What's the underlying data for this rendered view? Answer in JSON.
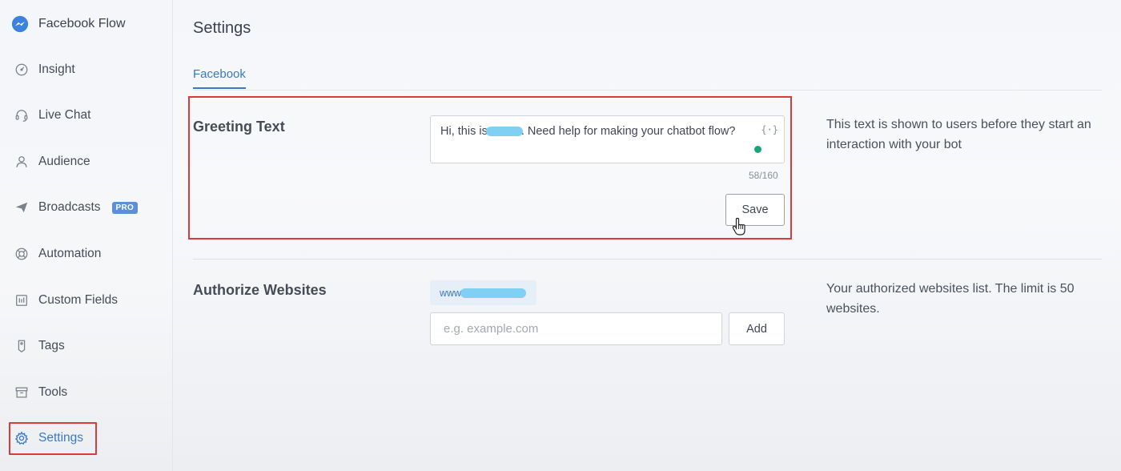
{
  "brand": {
    "label": "Facebook Flow",
    "icon": "messenger-icon"
  },
  "sidebar": {
    "items": [
      {
        "label": "Insight",
        "icon": "gauge-icon"
      },
      {
        "label": "Live Chat",
        "icon": "headset-icon"
      },
      {
        "label": "Audience",
        "icon": "user-icon"
      },
      {
        "label": "Broadcasts",
        "icon": "send-icon",
        "badge": "PRO"
      },
      {
        "label": "Automation",
        "icon": "lifebuoy-icon"
      },
      {
        "label": "Custom Fields",
        "icon": "columns-icon"
      },
      {
        "label": "Tags",
        "icon": "tag-icon"
      },
      {
        "label": "Tools",
        "icon": "toolbox-icon"
      },
      {
        "label": "Settings",
        "icon": "gear-icon",
        "active": true
      }
    ]
  },
  "page": {
    "title": "Settings"
  },
  "tabs": [
    {
      "label": "Facebook",
      "active": true
    }
  ],
  "greeting": {
    "title": "Greeting Text",
    "text_prefix": "Hi, this is",
    "text_suffix": ". Need help for making your chatbot flow?",
    "variable_icon": "{·}",
    "counter": "58/160",
    "save_label": "Save",
    "helper": "This text is shown to users before they start an interaction with your bot"
  },
  "authorize": {
    "title": "Authorize Websites",
    "chip_prefix": "www",
    "input_placeholder": "e.g. example.com",
    "add_label": "Add",
    "helper": "Your authorized websites list. The limit is 50 websites."
  },
  "colors": {
    "accent": "#3b78c3",
    "highlight": "#d93a3a",
    "status": "#1aa37a",
    "badge": "#5b8fd6"
  }
}
